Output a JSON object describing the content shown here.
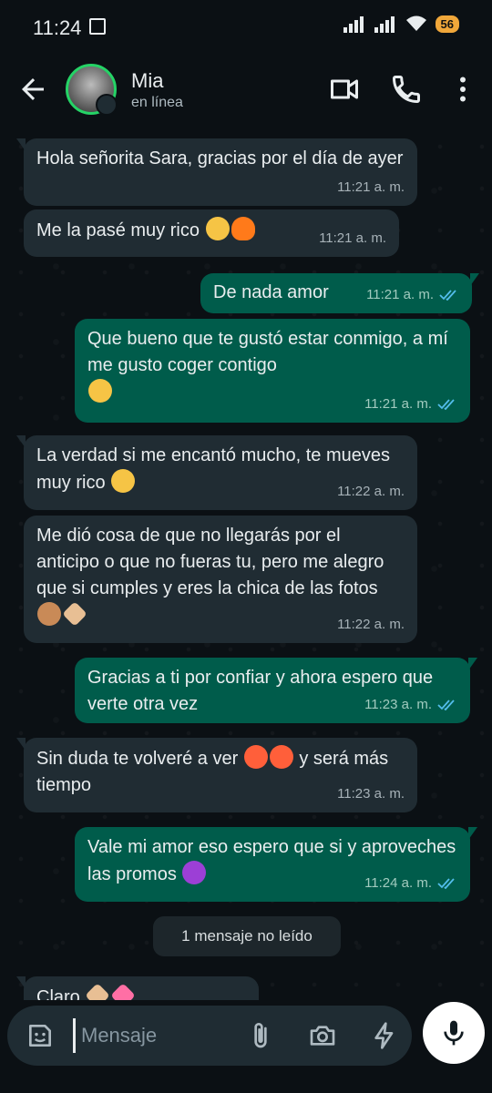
{
  "status_bar": {
    "time": "11:24",
    "battery": "56"
  },
  "header": {
    "contact_name": "Mia",
    "contact_status": "en línea"
  },
  "messages": [
    {
      "direction": "in",
      "text": "Hola señorita Sara, gracias por el día de ayer",
      "time": "11:21 a. m."
    },
    {
      "direction": "in",
      "text": "Me la pasé muy rico",
      "emojis": [
        "yum",
        "fire"
      ],
      "time": "11:21 a. m."
    },
    {
      "direction": "out",
      "text": "De nada amor",
      "time": "11:21 a. m.",
      "read": true
    },
    {
      "direction": "out",
      "text": "Que bueno que te gustó estar conmigo, a mí me gusto coger contigo",
      "emojis": [
        "shy"
      ],
      "time": "11:21 a. m.",
      "read": true
    },
    {
      "direction": "in",
      "text": "La verdad si me encantó mucho, te mueves muy rico",
      "emojis": [
        "yum"
      ],
      "time": "11:22 a. m."
    },
    {
      "direction": "in",
      "text": "Me dió cosa de que no llegarás por el anticipo o que no fueras tu, pero me alegro que si cumples y eres la chica de las fotos",
      "emojis": [
        "see-no-evil",
        "heart-hands"
      ],
      "time": "11:22 a. m."
    },
    {
      "direction": "out",
      "text": "Gracias a ti por confiar y ahora espero que verte otra vez",
      "time": "11:23 a. m.",
      "read": true
    },
    {
      "direction": "in",
      "text": "Sin duda te volveré a ver",
      "emojis": [
        "hot",
        "hot"
      ],
      "text_after": "y será más tiempo",
      "time": "11:23 a. m."
    },
    {
      "direction": "out",
      "text": "Vale mi amor eso espero que si y aproveches las promos",
      "emojis": [
        "devil"
      ],
      "time": "11:24 a. m.",
      "read": true
    }
  ],
  "unread_banner": "1 mensaje no leído",
  "partial_message": {
    "text": "Claro",
    "emojis": [
      "heart-hands",
      "pink-heart"
    ]
  },
  "composer": {
    "placeholder": "Mensaje"
  },
  "icons": {
    "back": "arrow-left-icon",
    "video": "video-call-icon",
    "call": "phone-icon",
    "menu": "more-vert-icon",
    "sticker": "sticker-icon",
    "attach": "paperclip-icon",
    "camera": "camera-icon",
    "bolt": "bolt-icon",
    "mic": "mic-icon"
  },
  "colors": {
    "background": "#0b1014",
    "incoming": "#202c33",
    "outgoing": "#005c4b",
    "accent": "#25d366",
    "read_tick": "#53bdeb"
  }
}
